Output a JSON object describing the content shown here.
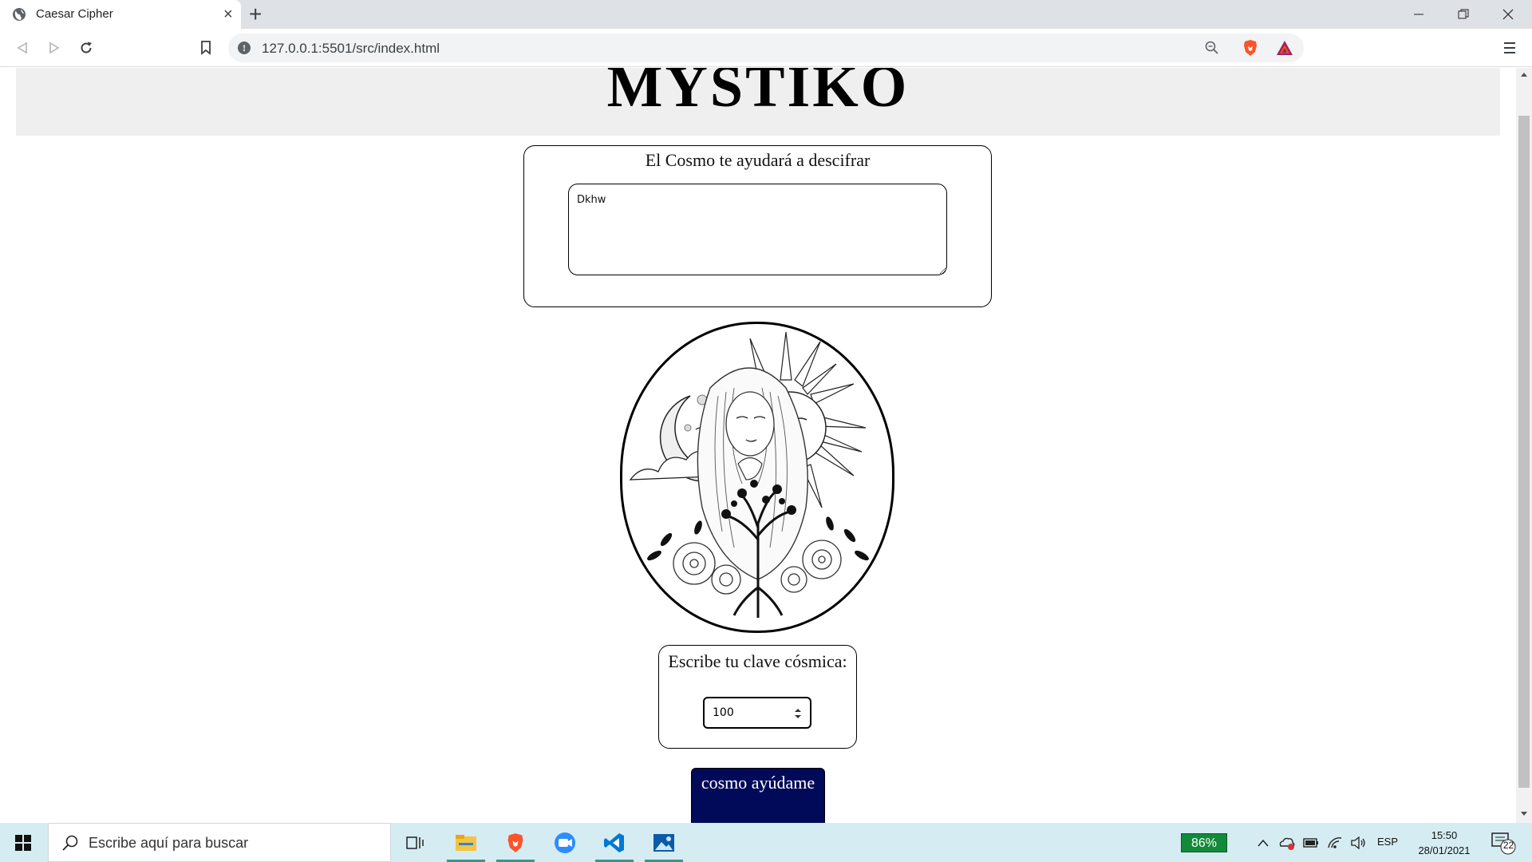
{
  "browser": {
    "tab_title": "Caesar Cipher",
    "new_tab": "+",
    "close_tab": "×",
    "url": "127.0.0.1:5501/src/index.html"
  },
  "page": {
    "brand": "MYSTIKO",
    "decipher_label": "El Cosmo te ayudará a descifrar",
    "message_value": "Dkhw",
    "key_label": "Escribe tu clave cósmica:",
    "key_value": "100",
    "button_label": "cosmo ayúdame"
  },
  "taskbar": {
    "search_placeholder": "Escribe aquí para buscar",
    "battery": "86%",
    "language": "ESP",
    "time": "15:50",
    "date": "28/01/2021",
    "notifications": "22"
  },
  "colors": {
    "button_bg": "#000a58",
    "header_band": "#efefef",
    "taskbar_bg": "#d5ecf2",
    "battery_bg": "#138a3a"
  },
  "icons": [
    "globe-icon",
    "back-icon",
    "forward-icon",
    "reload-icon",
    "bookmark-icon",
    "info-icon",
    "zoom-icon",
    "brave-shield-icon",
    "bat-rewards-icon",
    "menu-icon",
    "windows-start-icon",
    "search-icon",
    "task-view-icon",
    "file-explorer-icon",
    "brave-app-icon",
    "zoom-app-icon",
    "vscode-icon",
    "photos-icon"
  ]
}
